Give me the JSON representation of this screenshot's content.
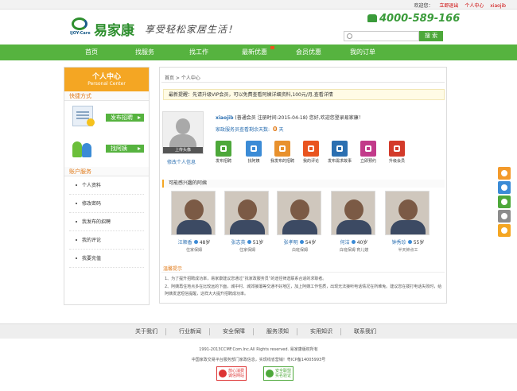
{
  "topbar": {
    "welcome": "欢迎您：",
    "logout": "立即退出",
    "center": "个人中心",
    "user": "xiaojib"
  },
  "header": {
    "logo_en": "IJOY-Care",
    "brand": "易家康",
    "slogan": "享受轻松家居生活！",
    "phone": "4000-589-166",
    "search_label": "搜 索",
    "search_placeholder": ""
  },
  "nav": [
    "首页",
    "找服务",
    "找工作",
    "最新优惠",
    "会员优惠",
    "我的订单"
  ],
  "sidebar": {
    "title": "个人中心",
    "subtitle": "Personal Center",
    "quick_title": "快捷方式",
    "publish_btn": "发布招聘",
    "find_btn": "找阿姨",
    "account_title": "账户服务",
    "items": [
      "个人资料",
      "修改密码",
      "我发布的招聘",
      "我的评论",
      "我要充值"
    ]
  },
  "main": {
    "breadcrumb": "首页 > 个人中心",
    "notice": "最新提醒：先请升级VIP会员，可以免费查看阿姨详细资料,100元/月,查看详情",
    "avatar_caption": "上传头像",
    "edit_link": "修改个人信息",
    "username": "xiaojib",
    "user_info": " (普通会员 注册时间:2015-04-18) 您好,欢迎您登录易家康！",
    "days_label": "家政服务员查看剩余天数:",
    "days_value": "0",
    "days_unit": "天",
    "functions": [
      {
        "label": "发布招聘",
        "color": "#4da83a",
        "icon": "search-icon"
      },
      {
        "label": "找阿姨",
        "color": "#3b8bd6",
        "icon": "person-icon"
      },
      {
        "label": "我发布的招聘",
        "color": "#e8912d",
        "icon": "document-icon"
      },
      {
        "label": "我的评论",
        "color": "#e9541f",
        "icon": "star-icon"
      },
      {
        "label": "发布需求故事",
        "color": "#2b6fb1",
        "icon": "house-icon"
      },
      {
        "label": "立即预约",
        "color": "#c23a8a",
        "icon": "calendar-icon"
      },
      {
        "label": "升级会员",
        "color": "#d33a2a",
        "icon": "gift-icon"
      }
    ],
    "rec_title": "可能感兴趣的阿姨",
    "recommend": [
      {
        "name": "汪顺香",
        "age": "48岁",
        "tag": "住家保姆"
      },
      {
        "name": "张志英",
        "age": "51岁",
        "tag": "住家保姆"
      },
      {
        "name": "张孝明",
        "age": "54岁",
        "tag": "白班保姆"
      },
      {
        "name": "何洁",
        "age": "40岁",
        "tag": "白班保姆 育儿嫂"
      },
      {
        "name": "钟秀珍",
        "age": "55岁",
        "tag": "半天钟点工"
      }
    ],
    "tips_title": "温馨提示",
    "tips": [
      "1、为了提升招聘成功率，易家康建议您通过“找家政服务员”的途径筛选联系合适的求职者。",
      "2、阿姨再住地点多在比较远的下面，城中村、城郊接壤等交通不好地区，加上阿姨工作性质，出现无法接听电话情况在所难免。建议您在拨打电话失败时，给阿姨发送短信提醒，这样大大提升招聘成功率。"
    ]
  },
  "footer": {
    "links": [
      "关于我们",
      "行业新闻",
      "安全保障",
      "服务须知",
      "实用知识",
      "联系我们"
    ],
    "copyright": "1991-2013CCMF.Com.Inc.All Rights reserved. 易家康版权所有",
    "license": "中国家政交易平台服务部门家政信息，实现线省营销！粤ICP备14005993号",
    "badge1": [
      "放心消费",
      "诚信网站"
    ],
    "badge2": [
      "安全联盟",
      "实名验证"
    ]
  }
}
